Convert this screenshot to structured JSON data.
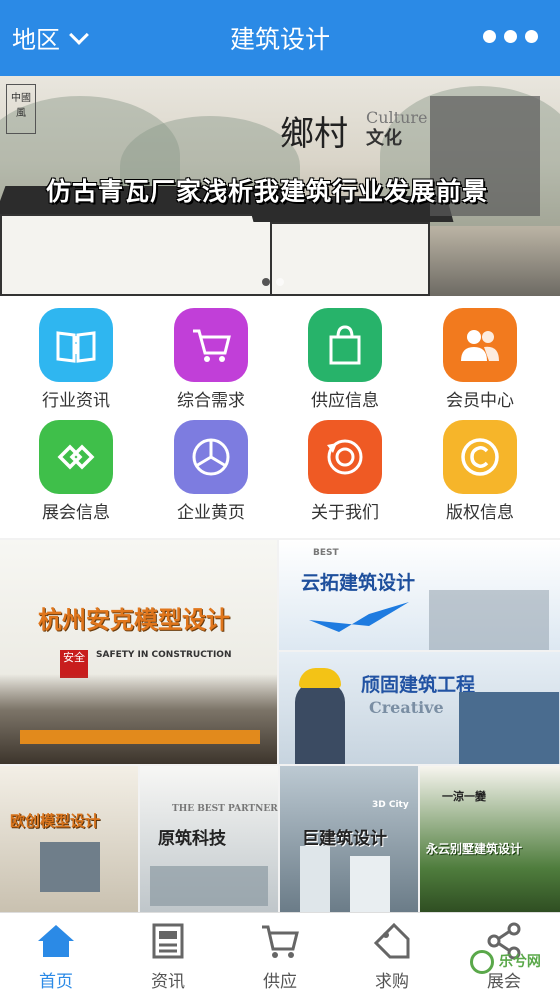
{
  "header": {
    "region_label": "地区",
    "title": "建筑设计"
  },
  "banner": {
    "headline": "仿古青瓦厂家浅析我建筑行业发展前景",
    "brush_title": "鄉村",
    "culture_en": "Culture",
    "culture_zh": "文化",
    "seal_text": "中國風"
  },
  "grid": [
    {
      "label": "行业资讯",
      "color": "#2fb6f0",
      "icon": "book-icon"
    },
    {
      "label": "综合需求",
      "color": "#c13fd8",
      "icon": "cart-icon"
    },
    {
      "label": "供应信息",
      "color": "#27b36a",
      "icon": "bag-icon"
    },
    {
      "label": "会员中心",
      "color": "#f27a1e",
      "icon": "users-icon"
    },
    {
      "label": "展会信息",
      "color": "#3fbf4a",
      "icon": "link-icon"
    },
    {
      "label": "企业黄页",
      "color": "#7d7ce0",
      "icon": "pie-icon"
    },
    {
      "label": "关于我们",
      "color": "#ef5a24",
      "icon": "refresh-icon"
    },
    {
      "label": "版权信息",
      "color": "#f6b52a",
      "icon": "copyright-icon"
    }
  ],
  "promos": {
    "p1": {
      "title": "杭州安克模型设计",
      "sub": "SAFETY IN CONSTRUCTION",
      "badge": "安全"
    },
    "p2": {
      "title": "云拓建筑设计",
      "sub": "BEST"
    },
    "p3": {
      "title": "颀固建筑工程",
      "sub": "Creative"
    },
    "p4": {
      "title": "欧创模型设计"
    },
    "p5": {
      "title": "原筑科技",
      "sub": "THE BEST PARTNER!"
    },
    "p6": {
      "title": "巨建筑设计",
      "sub": "3D City"
    },
    "p7": {
      "title": "永云别墅建筑设计",
      "sub": "一涼一變"
    }
  },
  "nav": [
    {
      "label": "首页",
      "icon": "home-icon",
      "active": true
    },
    {
      "label": "资讯",
      "icon": "news-icon",
      "active": false
    },
    {
      "label": "供应",
      "icon": "cart-icon",
      "active": false
    },
    {
      "label": "求购",
      "icon": "tag-icon",
      "active": false
    },
    {
      "label": "展会",
      "icon": "share-icon",
      "active": false
    }
  ],
  "watermark": "乐兮网"
}
